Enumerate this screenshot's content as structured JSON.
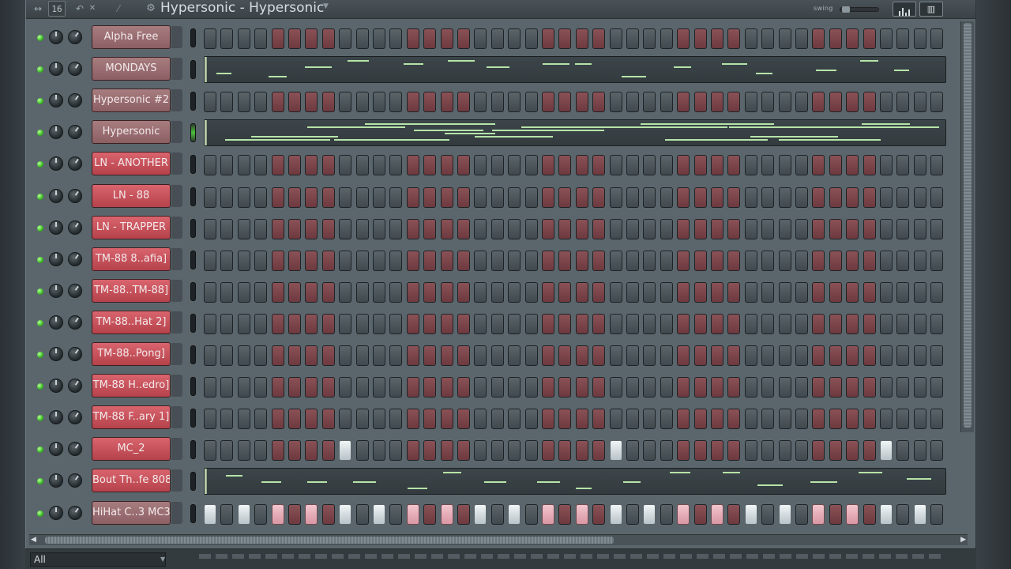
{
  "window": {
    "title": "Hypersonic - Hypersonic",
    "step_count": "16",
    "swing_label": "swing"
  },
  "icons": {
    "arrows": "↔",
    "undo": "↶",
    "close": "✕",
    "separator": "⁄",
    "gear": "⚙",
    "caret": "▼",
    "keys": "▥"
  },
  "channels": [
    {
      "name": "Alpha Free",
      "style": "plain",
      "type": "steps"
    },
    {
      "name": "MONDAYS",
      "style": "plain",
      "type": "pianoroll"
    },
    {
      "name": "Hypersonic #2",
      "style": "plain",
      "type": "steps"
    },
    {
      "name": "Hypersonic",
      "style": "plain",
      "type": "pianoroll",
      "selected": true
    },
    {
      "name": "LN - ANOTHER",
      "style": "red",
      "type": "steps"
    },
    {
      "name": "LN - 88",
      "style": "red",
      "type": "steps"
    },
    {
      "name": "LN - TRAPPER",
      "style": "red",
      "type": "steps"
    },
    {
      "name": "TM-88 8..afia]",
      "style": "red",
      "type": "steps"
    },
    {
      "name": "TM-88..TM-88]",
      "style": "red",
      "type": "steps"
    },
    {
      "name": "TM-88..Hat 2]",
      "style": "red",
      "type": "steps"
    },
    {
      "name": "TM-88..Pong]",
      "style": "red",
      "type": "steps"
    },
    {
      "name": "TM-88 H..edro]",
      "style": "red",
      "type": "steps"
    },
    {
      "name": "TM-88 F..ary 1]",
      "style": "red",
      "type": "steps"
    },
    {
      "name": "MC_2",
      "style": "red",
      "type": "steps",
      "active_steps": [
        8,
        24,
        40
      ]
    },
    {
      "name": "Bout Th..fe 808",
      "style": "red",
      "type": "pianoroll"
    },
    {
      "name": "HiHat C..3 MC38",
      "style": "plain",
      "type": "steps",
      "active_steps": [
        0,
        2,
        4,
        6,
        8,
        10,
        12,
        14,
        16,
        18,
        20,
        22,
        24,
        26,
        28,
        30,
        32,
        34,
        36,
        38,
        40,
        42
      ]
    }
  ],
  "filter": {
    "value": "All"
  },
  "colors": {
    "step_gray": "#4e575c",
    "step_red": "#7d4449",
    "channel_red": "#c9525a",
    "led_green": "#3fbf2a",
    "note_green": "#b6e4a8"
  }
}
